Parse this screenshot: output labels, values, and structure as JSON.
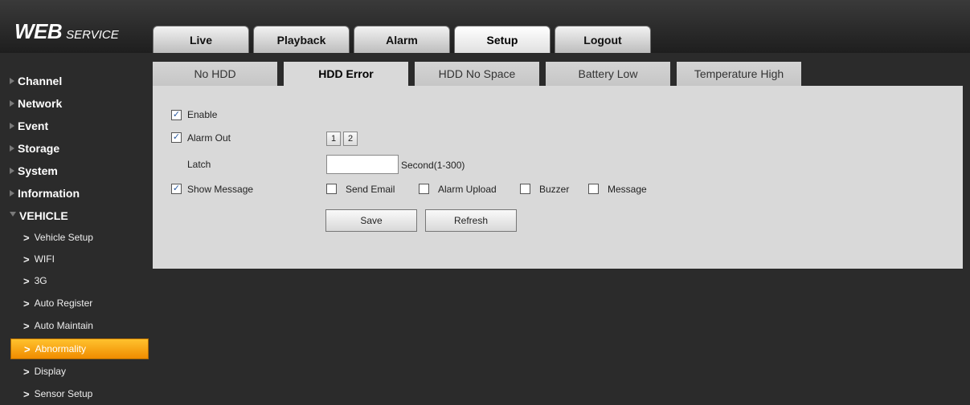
{
  "logo": {
    "big": "WEB",
    "small": "SERVICE"
  },
  "top_tabs": [
    {
      "label": "Live"
    },
    {
      "label": "Playback"
    },
    {
      "label": "Alarm"
    },
    {
      "label": "Setup",
      "active": true
    },
    {
      "label": "Logout"
    }
  ],
  "sidebar": {
    "items": [
      {
        "label": "Channel"
      },
      {
        "label": "Network"
      },
      {
        "label": "Event"
      },
      {
        "label": "Storage"
      },
      {
        "label": "System"
      },
      {
        "label": "Information"
      },
      {
        "label": "VEHICLE",
        "expanded": true
      }
    ],
    "sub_items": [
      {
        "label": "Vehicle Setup"
      },
      {
        "label": "WIFI"
      },
      {
        "label": "3G"
      },
      {
        "label": "Auto Register"
      },
      {
        "label": "Auto Maintain"
      },
      {
        "label": "Abnormality",
        "active": true
      },
      {
        "label": "Display"
      },
      {
        "label": "Sensor Setup"
      }
    ]
  },
  "sub_tabs": [
    {
      "label": "No HDD"
    },
    {
      "label": "HDD Error",
      "active": true
    },
    {
      "label": "HDD No Space"
    },
    {
      "label": "Battery Low"
    },
    {
      "label": "Temperature High"
    }
  ],
  "form": {
    "enable": {
      "label": "Enable",
      "checked": true
    },
    "alarm_out": {
      "label": "Alarm Out",
      "checked": true,
      "buttons": [
        "1",
        "2"
      ]
    },
    "latch": {
      "label": "Latch",
      "value": "",
      "unit": "Second(1-300)"
    },
    "show_message": {
      "label": "Show Message",
      "checked": true
    },
    "send_email": {
      "label": "Send Email",
      "checked": false
    },
    "alarm_upload": {
      "label": "Alarm Upload",
      "checked": false
    },
    "buzzer": {
      "label": "Buzzer",
      "checked": false
    },
    "message": {
      "label": "Message",
      "checked": false
    },
    "save_label": "Save",
    "refresh_label": "Refresh"
  },
  "colors": {
    "background": "#2b2b2b",
    "panel": "#d9d9d9",
    "active_side": "#f5a000"
  }
}
